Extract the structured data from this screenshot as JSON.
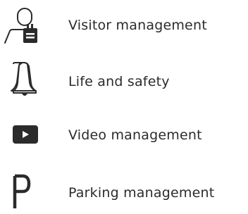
{
  "features": [
    {
      "label": "Visitor management",
      "icon": "visitor-badge-icon"
    },
    {
      "label": "Life and safety",
      "icon": "bell-icon"
    },
    {
      "label": "Video management",
      "icon": "video-play-icon"
    },
    {
      "label": "Parking management",
      "icon": "parking-sign-icon"
    }
  ],
  "colors": {
    "icon": "#2b2b2b",
    "text": "#2b2b2b",
    "background": "#ffffff"
  }
}
